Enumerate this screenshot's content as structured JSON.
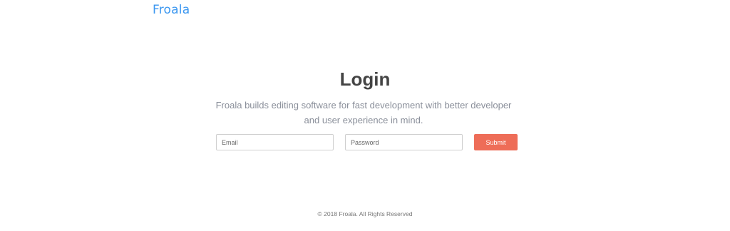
{
  "brand": {
    "logo_text": "Froala"
  },
  "login": {
    "title": "Login",
    "subtitle": "Froala builds editing software for fast development with better developer and user experience in mind."
  },
  "form": {
    "email_placeholder": "Email",
    "password_placeholder": "Password",
    "submit_label": "Submit"
  },
  "footer": {
    "copyright": "© 2018 Froala. All Rights Reserved"
  },
  "colors": {
    "brand": "#3b97f0",
    "title": "#444444",
    "subtitle": "#8a8f9a",
    "submit_bg": "#ee6d58",
    "footer": "#777777"
  }
}
